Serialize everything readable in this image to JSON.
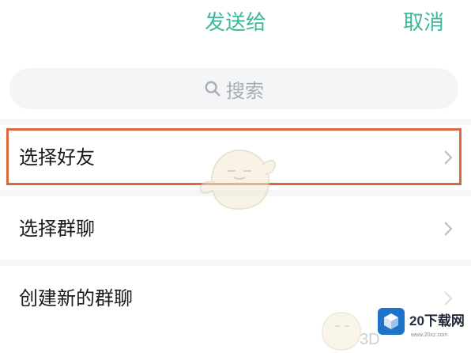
{
  "header": {
    "title": "发送给",
    "cancel_label": "取消"
  },
  "search": {
    "placeholder": "搜索"
  },
  "menu": {
    "items": [
      {
        "label": "选择好友",
        "has_chevron": true,
        "highlighted": true
      },
      {
        "label": "选择群聊",
        "has_chevron": true,
        "highlighted": false
      },
      {
        "label": "创建新的群聊",
        "has_chevron": true,
        "highlighted": false
      }
    ]
  },
  "watermark": {
    "logo_text": "20下载网",
    "logo_sub": "www.20xz.com",
    "overlay_text": "3D"
  },
  "colors": {
    "accent": "#3fb79a",
    "highlight_border": "#d96a3f",
    "logo_blue": "#1e73c9"
  }
}
